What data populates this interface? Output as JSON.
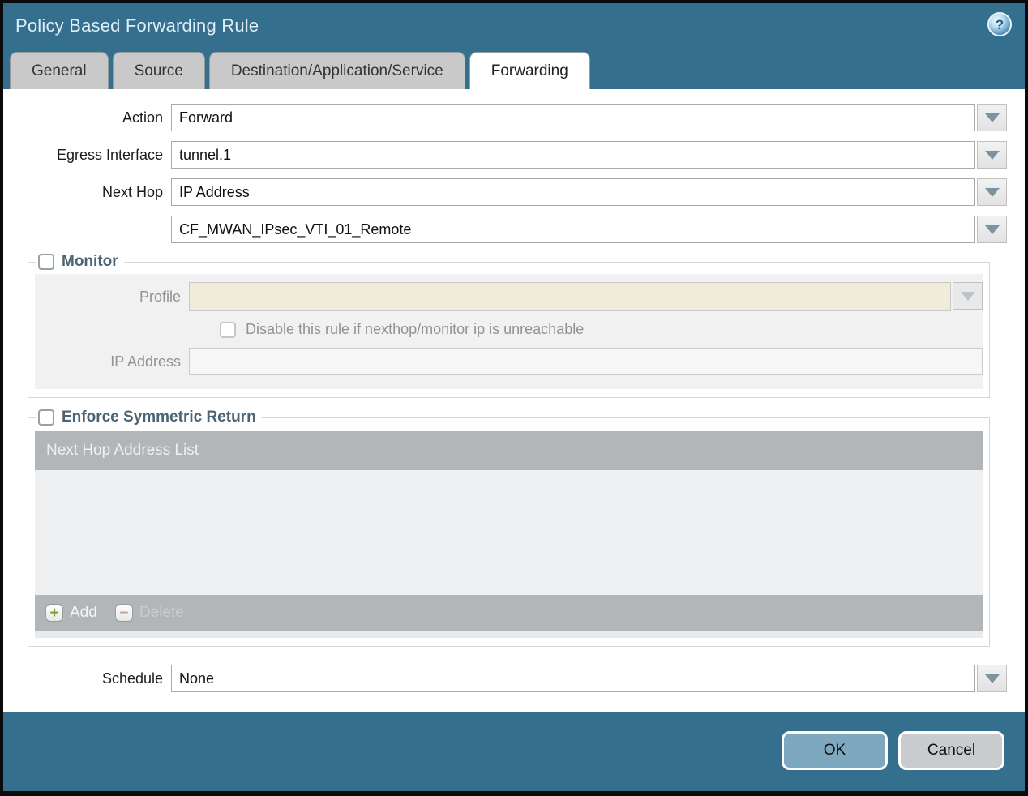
{
  "dialog": {
    "title": "Policy Based Forwarding Rule"
  },
  "icons": {
    "help": "?",
    "add": "+",
    "delete": "−"
  },
  "tabs": [
    {
      "label": "General"
    },
    {
      "label": "Source"
    },
    {
      "label": "Destination/Application/Service"
    },
    {
      "label": "Forwarding"
    }
  ],
  "form": {
    "action": {
      "label": "Action",
      "value": "Forward"
    },
    "egress_interface": {
      "label": "Egress Interface",
      "value": "tunnel.1"
    },
    "next_hop": {
      "label": "Next Hop",
      "value": "IP Address"
    },
    "next_hop_address": {
      "value": "CF_MWAN_IPsec_VTI_01_Remote"
    },
    "schedule": {
      "label": "Schedule",
      "value": "None"
    }
  },
  "monitor": {
    "legend": "Monitor",
    "checked": false,
    "profile_label": "Profile",
    "profile_value": "",
    "disable_checkbox_label": "Disable this rule if nexthop/monitor ip is unreachable",
    "disable_checked": false,
    "ip_address_label": "IP Address",
    "ip_address_value": ""
  },
  "symmetric_return": {
    "legend": "Enforce Symmetric Return",
    "checked": false,
    "table": {
      "header": "Next Hop Address List",
      "rows": [],
      "add_label": "Add",
      "delete_label": "Delete",
      "delete_enabled": false
    }
  },
  "footer": {
    "ok_label": "OK",
    "cancel_label": "Cancel"
  },
  "colors": {
    "titlebar_teal": "#346f8e",
    "tab_inactive": "#c9c9c9",
    "table_gray": "#b2b6b9",
    "profile_beige": "#f1ecd9",
    "ok_button_blue": "#7da8c0",
    "cancel_button_gray": "#c9cbce",
    "legend_slate": "#4b6372"
  }
}
